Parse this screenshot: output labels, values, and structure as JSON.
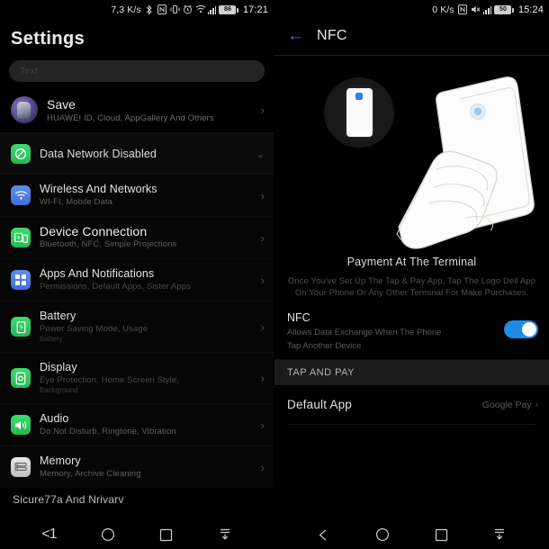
{
  "left": {
    "statusbar": {
      "netspeed": "7,3 K/s",
      "battery": "86",
      "clock": "17:21",
      "icons": [
        "bluetooth-icon",
        "nfc-icon",
        "vibrate-icon",
        "alarm-icon",
        "wifi-icon",
        "signal-icon",
        "battery-icon"
      ]
    },
    "title": "Settings",
    "search": {
      "placeholder": "Text"
    },
    "account": {
      "title": "Save",
      "subtitle": "HUAWEI ID, Cloud, AppGallery And Others",
      "chevron": "›"
    },
    "data_row": {
      "title": "Data Network Disabled",
      "caret": "⌄"
    },
    "items": [
      {
        "title": "Wireless And Networks",
        "subtitle": "WI-FI, Mobile Data",
        "subtitle2": "",
        "icon": "wifi-icon",
        "tone": "blue",
        "big": false
      },
      {
        "title": "Device Connection",
        "subtitle": "Bluetooth, NFC, Simple Projections",
        "subtitle2": "",
        "icon": "device-connection-icon",
        "tone": "green",
        "big": true
      },
      {
        "title": "Apps And Notifications",
        "subtitle": "Permissions, Default Apps, Sister Apps",
        "subtitle2": "",
        "icon": "apps-grid-icon",
        "tone": "blue",
        "big": false
      },
      {
        "title": "Battery",
        "subtitle": "Power Saving Mode, Usage",
        "subtitle2": "Battery",
        "icon": "battery-icon",
        "tone": "green",
        "big": false
      },
      {
        "title": "Display",
        "subtitle": "Eye Protection, Home Screen Style,",
        "subtitle2": "Background",
        "icon": "display-icon",
        "tone": "green",
        "big": false
      },
      {
        "title": "Audio",
        "subtitle": "Do Not Disturb, Ringtone, Vibration",
        "subtitle2": "",
        "icon": "audio-icon",
        "tone": "green",
        "big": false
      },
      {
        "title": "Memory",
        "subtitle": "Memory, Archive Cleaning",
        "subtitle2": "",
        "icon": "memory-icon",
        "tone": "white",
        "big": false
      }
    ],
    "footer_label": "Sicure77a And Nrivarv",
    "chevron": "›"
  },
  "right": {
    "statusbar": {
      "netspeed": "0 K/s",
      "battery": "50",
      "clock": "15:24",
      "icons": [
        "nfc-icon",
        "mute-icon",
        "signal-icon",
        "battery-icon"
      ]
    },
    "header": {
      "back": "←",
      "title": "NFC"
    },
    "illustration": {
      "name": "nfc-tap-to-pay-illustration",
      "bubble_device": "mini-phone-nfc-logo"
    },
    "payment": {
      "title": "Payment At The Terminal",
      "description": "Once You've Set Up The Tap & Pay App, Tap The Logo Dell App On Your Phone Or Any Other Terminal For Make Purchases."
    },
    "nfc_toggle": {
      "label": "NFC",
      "sub_line1": "Allows Data Exchange When The Phone",
      "sub_line2": "Tap Another Device",
      "state": "on"
    },
    "tap_and_pay": {
      "section": "TAP AND PAY",
      "default_app_label": "Default App",
      "default_app_value": "Google Pay",
      "chevron": "›"
    }
  },
  "navbar": {
    "back": "◁",
    "back_left_text": "<1",
    "home": "○",
    "recents": "□",
    "collapse": "collapse-keyboard-icon"
  },
  "colors": {
    "accent_blue": "#1c8ae6",
    "link_blue": "#3a7fe0",
    "icon_green": "#3ddc6f",
    "icon_blue": "#5b8ff0",
    "background": "#000000"
  }
}
